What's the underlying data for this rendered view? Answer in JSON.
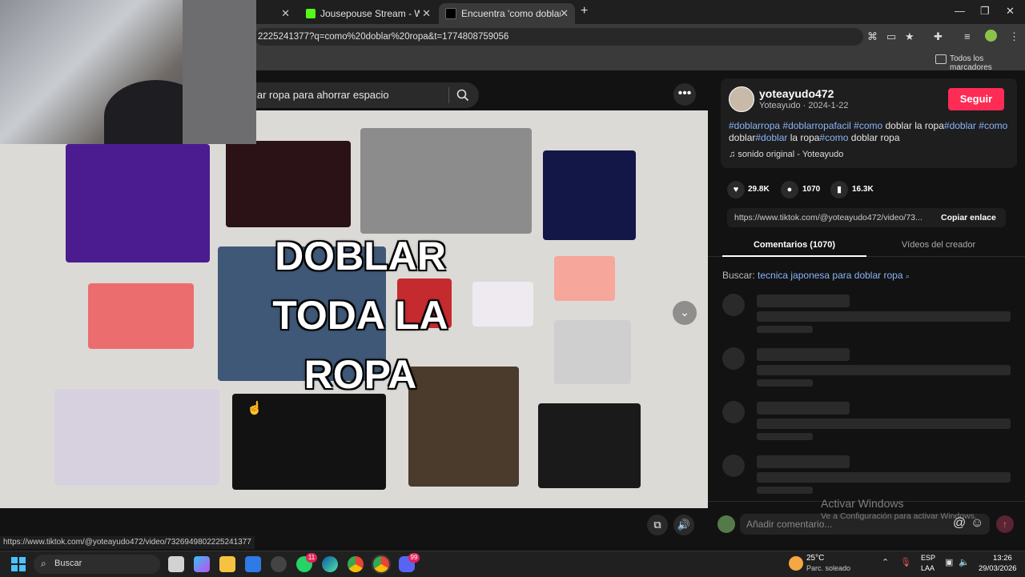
{
  "browser": {
    "tabs": [
      {
        "title": "Jousepouse Stream - Watch Liv",
        "favicon": "kick-icon",
        "active": false
      },
      {
        "title": "Encuentra 'como doblar ropa' e",
        "favicon": "tiktok-icon",
        "active": true
      }
    ],
    "new_tab": "+",
    "url": "2225241377?q=como%20doblar%20ropa&t=1774808759056",
    "bookmarks_label": "Todos los marcadores"
  },
  "tiktok": {
    "search_value": "lar ropa para ahorrar espacio",
    "video_overlay_text": [
      "DOBLAR",
      "TODA LA",
      "ROPA"
    ],
    "author": {
      "username": "yoteayudo472",
      "display_name": "Yoteayudo",
      "date": "2024-1-22",
      "follow_label": "Seguir"
    },
    "caption_parts": [
      {
        "text": "#doblarropa",
        "tag": true
      },
      {
        "text": " ",
        "tag": false
      },
      {
        "text": "#doblarropafacil",
        "tag": true
      },
      {
        "text": " ",
        "tag": false
      },
      {
        "text": "#como",
        "tag": true
      },
      {
        "text": " doblar la ropa",
        "tag": false
      },
      {
        "text": "#doblar",
        "tag": true
      },
      {
        "text": " ",
        "tag": false
      },
      {
        "text": "#como",
        "tag": true
      },
      {
        "text": " doblar",
        "tag": false
      },
      {
        "text": "#doblar",
        "tag": true
      },
      {
        "text": " la ropa",
        "tag": false
      },
      {
        "text": "#como",
        "tag": true
      },
      {
        "text": " doblar ropa",
        "tag": false
      }
    ],
    "sound": "sonido original - Yoteayudo",
    "stats": {
      "likes": "29.8K",
      "comments": "1070",
      "saves": "16.3K"
    },
    "share_url": "https://www.tiktok.com/@yoteayudo472/video/73...",
    "copy_link_label": "Copiar enlace",
    "tabs": {
      "comments": "Comentarios (1070)",
      "creator_videos": "Vídeos del creador"
    },
    "related_search_label": "Buscar:",
    "related_search_value": "tecnica japonesa para doblar ropa",
    "comment_placeholder": "Añadir comentario...",
    "status_url": "https://www.tiktok.com/@yoteayudo472/video/7326949802225241377"
  },
  "windows_watermark": {
    "title": "Activar Windows",
    "subtitle": "Ve a Configuración para activar Windows."
  },
  "taskbar": {
    "search_label": "Buscar",
    "weather_temp": "25°C",
    "weather_desc": "Parc. soleado",
    "lang_top": "ESP",
    "lang_bottom": "LAA",
    "time": "13:26",
    "date": "29/03/2026",
    "whatsapp_badge": "11",
    "discord_badge": "99"
  },
  "colors": {
    "accent_pink": "#fe2c55",
    "hashtag_blue": "#8ab4f8",
    "related_blue": "#8ab4f8"
  }
}
